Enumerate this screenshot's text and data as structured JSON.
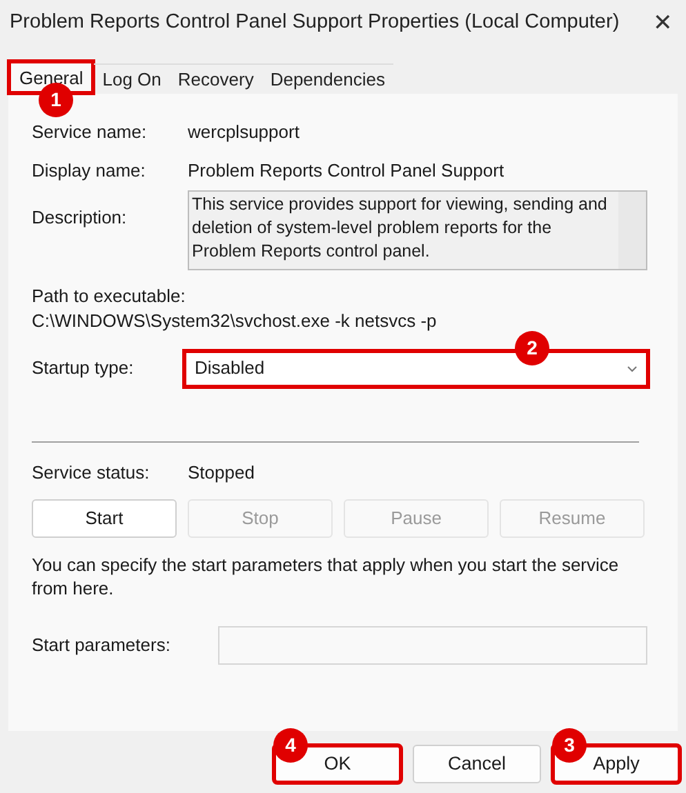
{
  "window": {
    "title": "Problem Reports Control Panel Support Properties (Local Computer)",
    "close": "✕"
  },
  "tabs": [
    {
      "label": "General",
      "selected": true,
      "callout": "1"
    },
    {
      "label": "Log On",
      "selected": false
    },
    {
      "label": "Recovery",
      "selected": false
    },
    {
      "label": "Dependencies",
      "selected": false
    }
  ],
  "service_name": {
    "label": "Service name:",
    "value": "wercplsupport"
  },
  "display_name": {
    "label": "Display name:",
    "value": "Problem Reports Control Panel Support"
  },
  "description": {
    "label": "Description:",
    "value": "This service provides support for viewing, sending and deletion of system-level problem reports for the Problem Reports control panel."
  },
  "path": {
    "label": "Path to executable:",
    "value": "C:\\WINDOWS\\System32\\svchost.exe -k netsvcs -p"
  },
  "startup_type": {
    "label": "Startup type:",
    "value": "Disabled",
    "callout": "2"
  },
  "service_status": {
    "label": "Service status:",
    "value": "Stopped"
  },
  "service_buttons": [
    {
      "label": "Start",
      "disabled": false
    },
    {
      "label": "Stop",
      "disabled": true
    },
    {
      "label": "Pause",
      "disabled": true
    },
    {
      "label": "Resume",
      "disabled": true
    }
  ],
  "hint": "You can specify the start parameters that apply when you start the service from here.",
  "start_parameters": {
    "label": "Start parameters:"
  },
  "dialog_buttons": [
    {
      "label": "OK",
      "callout": "4"
    },
    {
      "label": "Cancel"
    },
    {
      "label": "Apply",
      "callout": "3"
    }
  ]
}
